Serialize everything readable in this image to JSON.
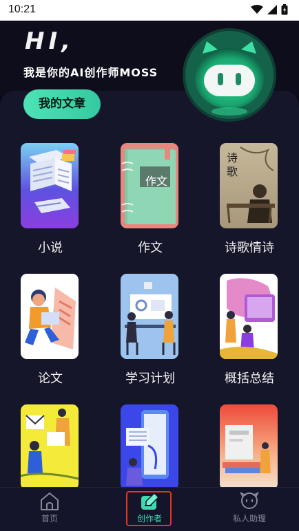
{
  "status_bar": {
    "time": "10:21"
  },
  "header": {
    "greeting": "HI",
    "greeting_punct": ",",
    "tagline": "我是你的AI创作师MOSS",
    "my_articles_label": "我的文章"
  },
  "cards": [
    {
      "label": "小说",
      "thumb_icon": "novel-books-image"
    },
    {
      "label": "作文",
      "thumb_icon": "composition-book-image",
      "thumb_text": "作文"
    },
    {
      "label": "诗歌情诗",
      "thumb_icon": "poetry-painting-image",
      "thumb_text": "诗歌"
    },
    {
      "label": "论文",
      "thumb_icon": "thesis-student-image"
    },
    {
      "label": "学习计划",
      "thumb_icon": "study-plan-image"
    },
    {
      "label": "概括总结",
      "thumb_icon": "summary-presentation-image"
    },
    {
      "label": "",
      "thumb_icon": "report-image"
    },
    {
      "label": "",
      "thumb_icon": "document-image"
    },
    {
      "label": "",
      "thumb_icon": "reading-image"
    }
  ],
  "bottom_nav": [
    {
      "label": "首页",
      "icon": "home-icon",
      "active": false
    },
    {
      "label": "创作者",
      "icon": "creator-icon",
      "active": true
    },
    {
      "label": "私人助理",
      "icon": "assistant-icon",
      "active": false
    }
  ],
  "colors": {
    "accent": "#41d8b0",
    "highlight": "#e5351e",
    "background": "#0b0b18"
  }
}
